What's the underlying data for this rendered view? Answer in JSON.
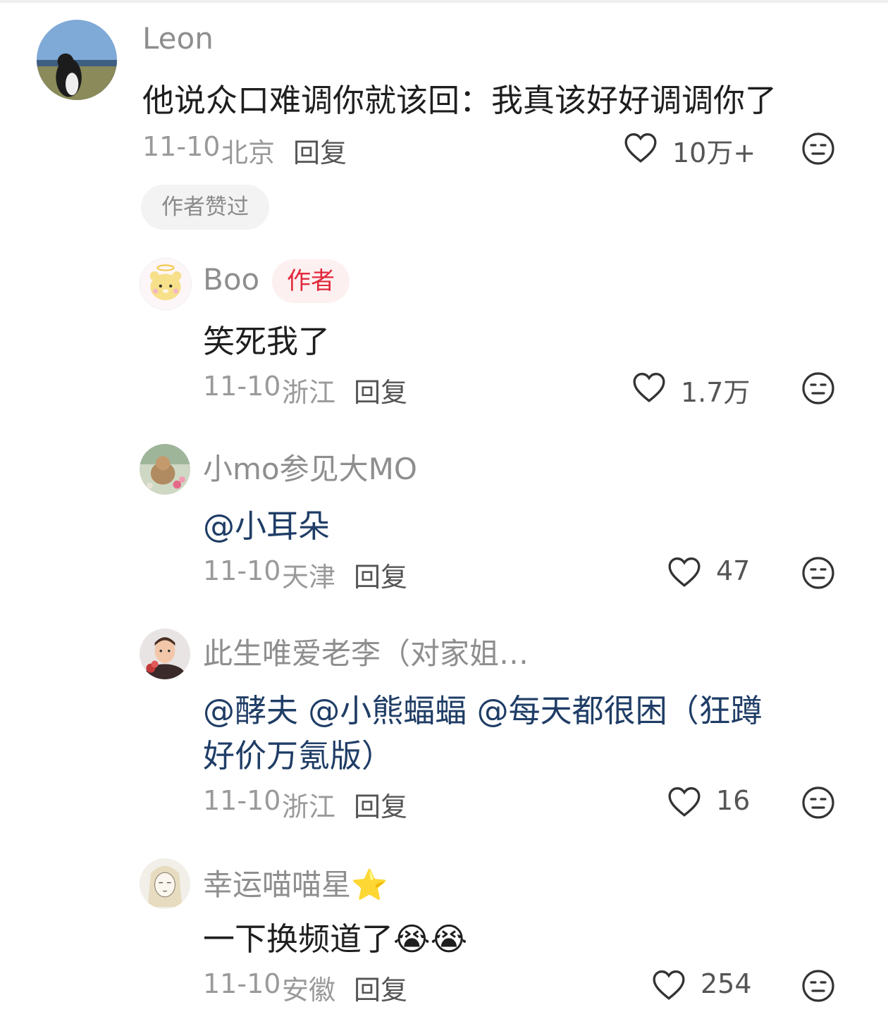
{
  "comments": [
    {
      "username": "Leon",
      "text": "他说众口难调你就该回：我真该好好调调你了",
      "date": "11-10",
      "location": "北京",
      "reply_label": "回复",
      "likes": "10万+",
      "chip": "作者赞过"
    },
    {
      "username": "Boo",
      "author_tag": "作者",
      "text": "笑死我了",
      "date": "11-10",
      "location": "浙江",
      "reply_label": "回复",
      "likes": "1.7万"
    },
    {
      "username": "小mo参见大MO",
      "text": "@小耳朵",
      "date": "11-10",
      "location": "天津",
      "reply_label": "回复",
      "likes": "47"
    },
    {
      "username": "此生唯爱老李（对家姐…",
      "text_line1": "@酵夫 @小熊蝠蝠 @每天都很困（狂蹲",
      "text_line2": "好价万氪版）",
      "date": "11-10",
      "location": "浙江",
      "reply_label": "回复",
      "likes": "16"
    },
    {
      "username": "幸运喵喵星⭐",
      "text": "一下换频道了",
      "emojis": "😭😭",
      "date": "11-10",
      "location": "安徽",
      "reply_label": "回复",
      "likes": "254"
    }
  ],
  "icons": {
    "like": "heart-outline-icon",
    "dislike": "meh-face-icon"
  },
  "colors": {
    "mention": "#1f3d66",
    "author_tag_text": "#e1293b",
    "author_tag_bg": "#fdf0f1",
    "meta_gray": "#9a9a9a"
  }
}
